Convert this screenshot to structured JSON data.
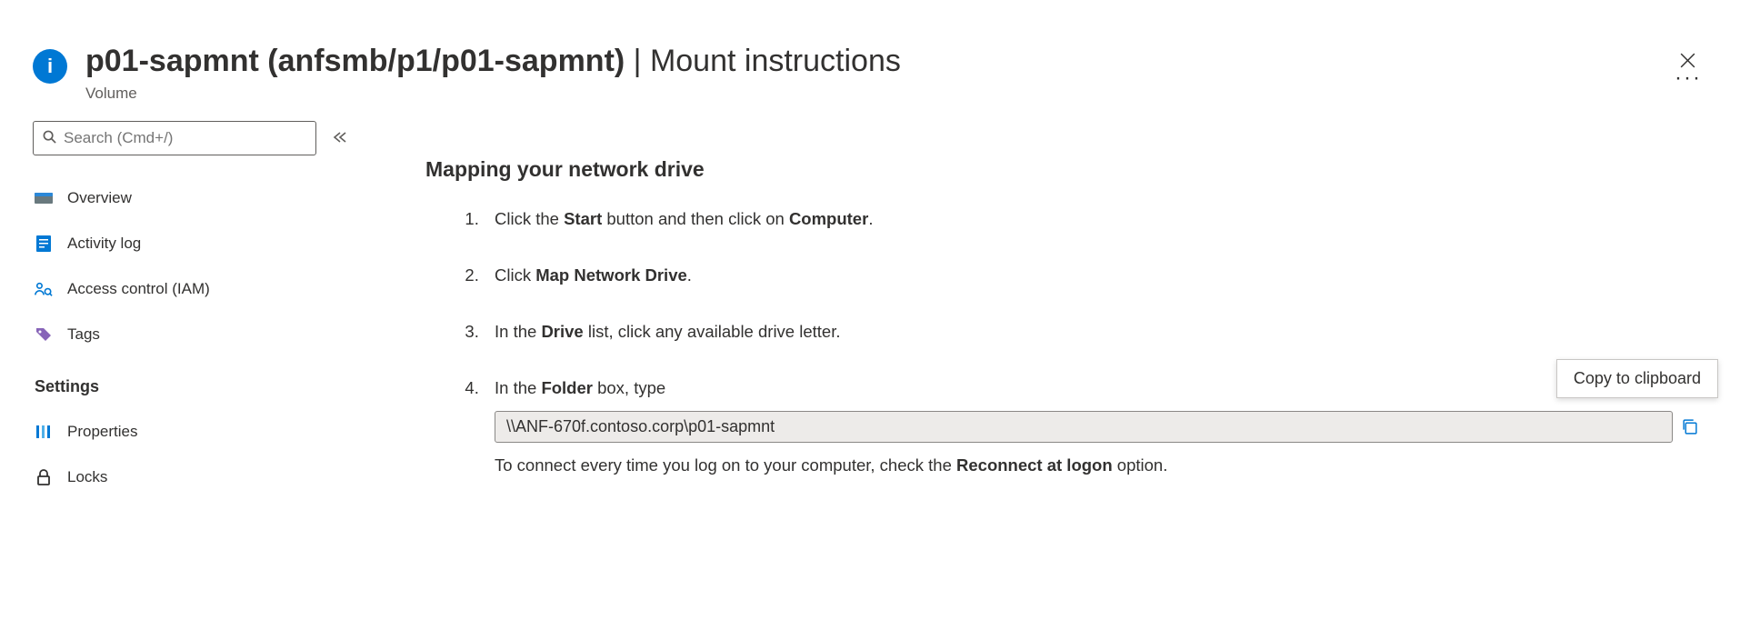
{
  "header": {
    "title_bold": "p01-sapmnt (anfsmb/p1/p01-sapmnt)",
    "title_separator": " | ",
    "title_rest": "Mount instructions",
    "subtitle": "Volume",
    "more_symbol": "···"
  },
  "sidebar": {
    "search_placeholder": "Search (Cmd+/)",
    "items": {
      "overview": "Overview",
      "activity": "Activity log",
      "access": "Access control (IAM)",
      "tags": "Tags"
    },
    "group_settings": "Settings",
    "settings_items": {
      "properties": "Properties",
      "locks": "Locks"
    }
  },
  "content": {
    "section_title": "Mapping your network drive",
    "step1_pre": "Click the ",
    "step1_b1": "Start",
    "step1_mid": " button and then click on ",
    "step1_b2": "Computer",
    "step1_post": ".",
    "step2_pre": "Click ",
    "step2_b1": "Map Network Drive",
    "step2_post": ".",
    "step3_pre": "In the ",
    "step3_b1": "Drive",
    "step3_post": " list, click any available drive letter.",
    "step4_pre": "In the ",
    "step4_b1": "Folder",
    "step4_post": " box, type",
    "folder_path": "\\\\ANF-670f.contoso.corp\\p01-sapmnt",
    "note_pre": "To connect every time you log on to your computer, check the ",
    "note_b1": "Reconnect at logon",
    "note_post": " option.",
    "tooltip": "Copy to clipboard"
  }
}
